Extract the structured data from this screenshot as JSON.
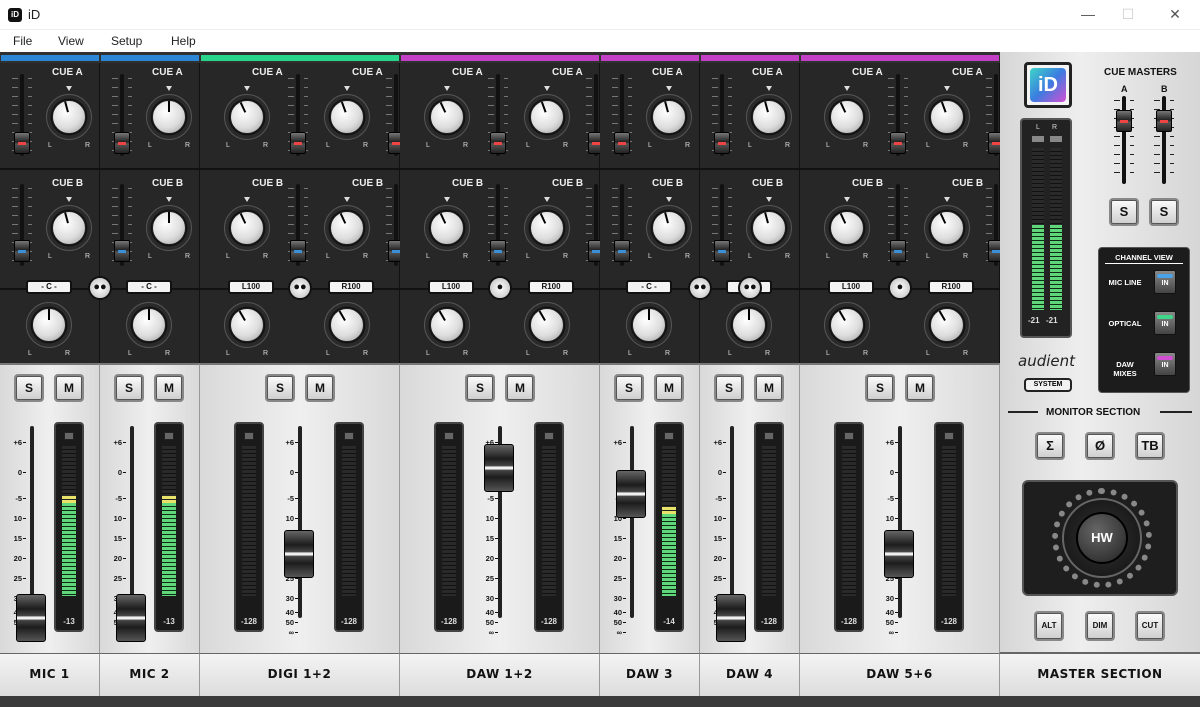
{
  "window": {
    "title": "iD",
    "icon_text": "iD",
    "controls": {
      "minimize": "—",
      "maximize": "☐",
      "close": "✕"
    }
  },
  "menu": [
    "File",
    "View",
    "Setup",
    "Help"
  ],
  "colors": {
    "blue": "#2c86d6",
    "green": "#29d48b",
    "magenta": "#c23fc6"
  },
  "groups": [
    {
      "name": "MIC 1",
      "color": "blue",
      "strips": 1
    },
    {
      "name": "MIC 2",
      "color": "blue",
      "strips": 1
    },
    {
      "name": "DIGI 1+2",
      "color": "green",
      "strips": 2
    },
    {
      "name": "DAW 1+2",
      "color": "magenta",
      "strips": 2
    },
    {
      "name": "DAW 3",
      "color": "magenta",
      "strips": 1
    },
    {
      "name": "DAW 4",
      "color": "magenta",
      "strips": 1
    },
    {
      "name": "DAW 5+6",
      "color": "magenta",
      "strips": 2
    },
    {
      "name": "MASTER SECTION",
      "color": "none",
      "strips": 0
    }
  ],
  "labels": {
    "cue_a": "CUE A",
    "cue_b": "CUE B",
    "knob_l": "L",
    "knob_r": "R",
    "solo": "S",
    "mute": "M"
  },
  "pan_boxes": [
    "- C -",
    "- C -",
    "L100",
    "R100",
    "L100",
    "R100",
    "- C -",
    "- C -",
    "L100",
    "R100"
  ],
  "link_icons": [
    "stereo-link-off",
    "mono",
    "stereo-link-off",
    "mono"
  ],
  "link_glyphs": {
    "stereo-link-off": "●●",
    "mono": "●"
  },
  "fader_scale": [
    "+6",
    "0",
    "-5",
    "10",
    "15",
    "20",
    "25",
    "30",
    "40",
    "50",
    "∞"
  ],
  "fader_levels_db": [
    "50",
    "50",
    "20",
    "20",
    "0",
    "0",
    "5",
    "50",
    "20",
    "20"
  ],
  "meter_readouts": [
    "-13",
    "-13",
    "-128",
    "-128",
    "-128",
    "-128",
    "-14",
    "-128",
    "-128",
    "-128"
  ],
  "meter_levels": [
    0.62,
    0.62,
    0,
    0,
    0,
    0,
    0.55,
    0,
    0,
    0
  ],
  "master": {
    "logo": "iD",
    "cue_masters_title": "CUE MASTERS",
    "cue_a": "A",
    "cue_b": "B",
    "solo": "S",
    "meter_readouts": [
      "-21",
      "-21"
    ],
    "meter_labels": [
      "L",
      "R"
    ],
    "brand": "audient",
    "system_button": "SYSTEM",
    "channel_view": {
      "title": "CHANNEL VIEW",
      "items": [
        {
          "label": "MIC LINE",
          "button": "IN",
          "led": "#4aa3e8"
        },
        {
          "label": "OPTICAL",
          "button": "IN",
          "led": "#3fd68a"
        },
        {
          "label": "DAW MIXES",
          "button": "IN",
          "led": "#d24fd4"
        }
      ]
    },
    "monitor_section": "MONITOR SECTION",
    "monitor_buttons": [
      "Σ",
      "Ø",
      "TB"
    ],
    "hw_label": "HW",
    "bottom_buttons": [
      "ALT",
      "DIM",
      "CUT"
    ]
  }
}
